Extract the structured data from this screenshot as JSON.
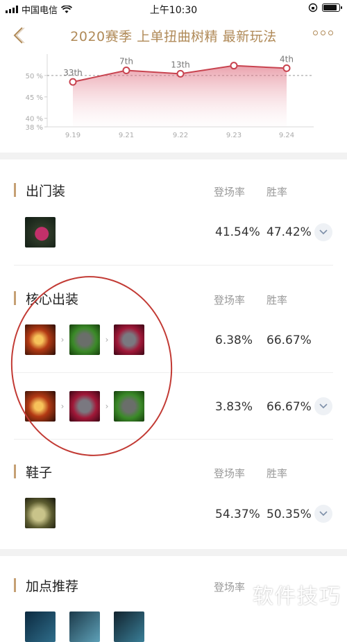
{
  "status_bar": {
    "carrier": "中国电信",
    "time": "上午10:30"
  },
  "nav": {
    "title": "2020赛季 上单扭曲树精 最新玩法"
  },
  "chart_data": {
    "type": "area",
    "x": [
      "9.19",
      "9.21",
      "9.22",
      "9.23",
      "9.24"
    ],
    "y": [
      48.5,
      51.2,
      50.4,
      52.3,
      51.7
    ],
    "point_labels": [
      "33th",
      "7th",
      "13th",
      "",
      "4th"
    ],
    "ylim": [
      38,
      55
    ],
    "y_ticks": [
      38,
      40,
      45,
      50
    ],
    "y_tick_labels": [
      "38 %",
      "40 %",
      "45 %",
      "50 %"
    ],
    "reference_line": 50,
    "accent": "#c8434f"
  },
  "column_headers": {
    "pick_rate": "登场率",
    "win_rate": "胜率"
  },
  "sections": {
    "starting": {
      "title": "出门装",
      "rows": [
        {
          "items": [
            "flask-icon"
          ],
          "pick": "41.54%",
          "win": "47.42%"
        }
      ]
    },
    "core": {
      "title": "核心出装",
      "rows": [
        {
          "items": [
            "gauntlet-icon",
            "green-armor-icon",
            "red-armor-icon"
          ],
          "pick": "6.38%",
          "win": "66.67%"
        },
        {
          "items": [
            "gauntlet-icon",
            "red-armor-icon",
            "green-armor-icon"
          ],
          "pick": "3.83%",
          "win": "66.67%"
        }
      ]
    },
    "boots": {
      "title": "鞋子",
      "rows": [
        {
          "items": [
            "boots-icon"
          ],
          "pick": "54.37%",
          "win": "50.35%"
        }
      ]
    },
    "skills": {
      "title": "加点推荐",
      "pick_rate_partial": "登场率"
    }
  },
  "watermark": "软件技巧",
  "colors": {
    "gold": "#b08a58",
    "accent_bar": "#c5a074",
    "annotation": "#c23a34"
  }
}
